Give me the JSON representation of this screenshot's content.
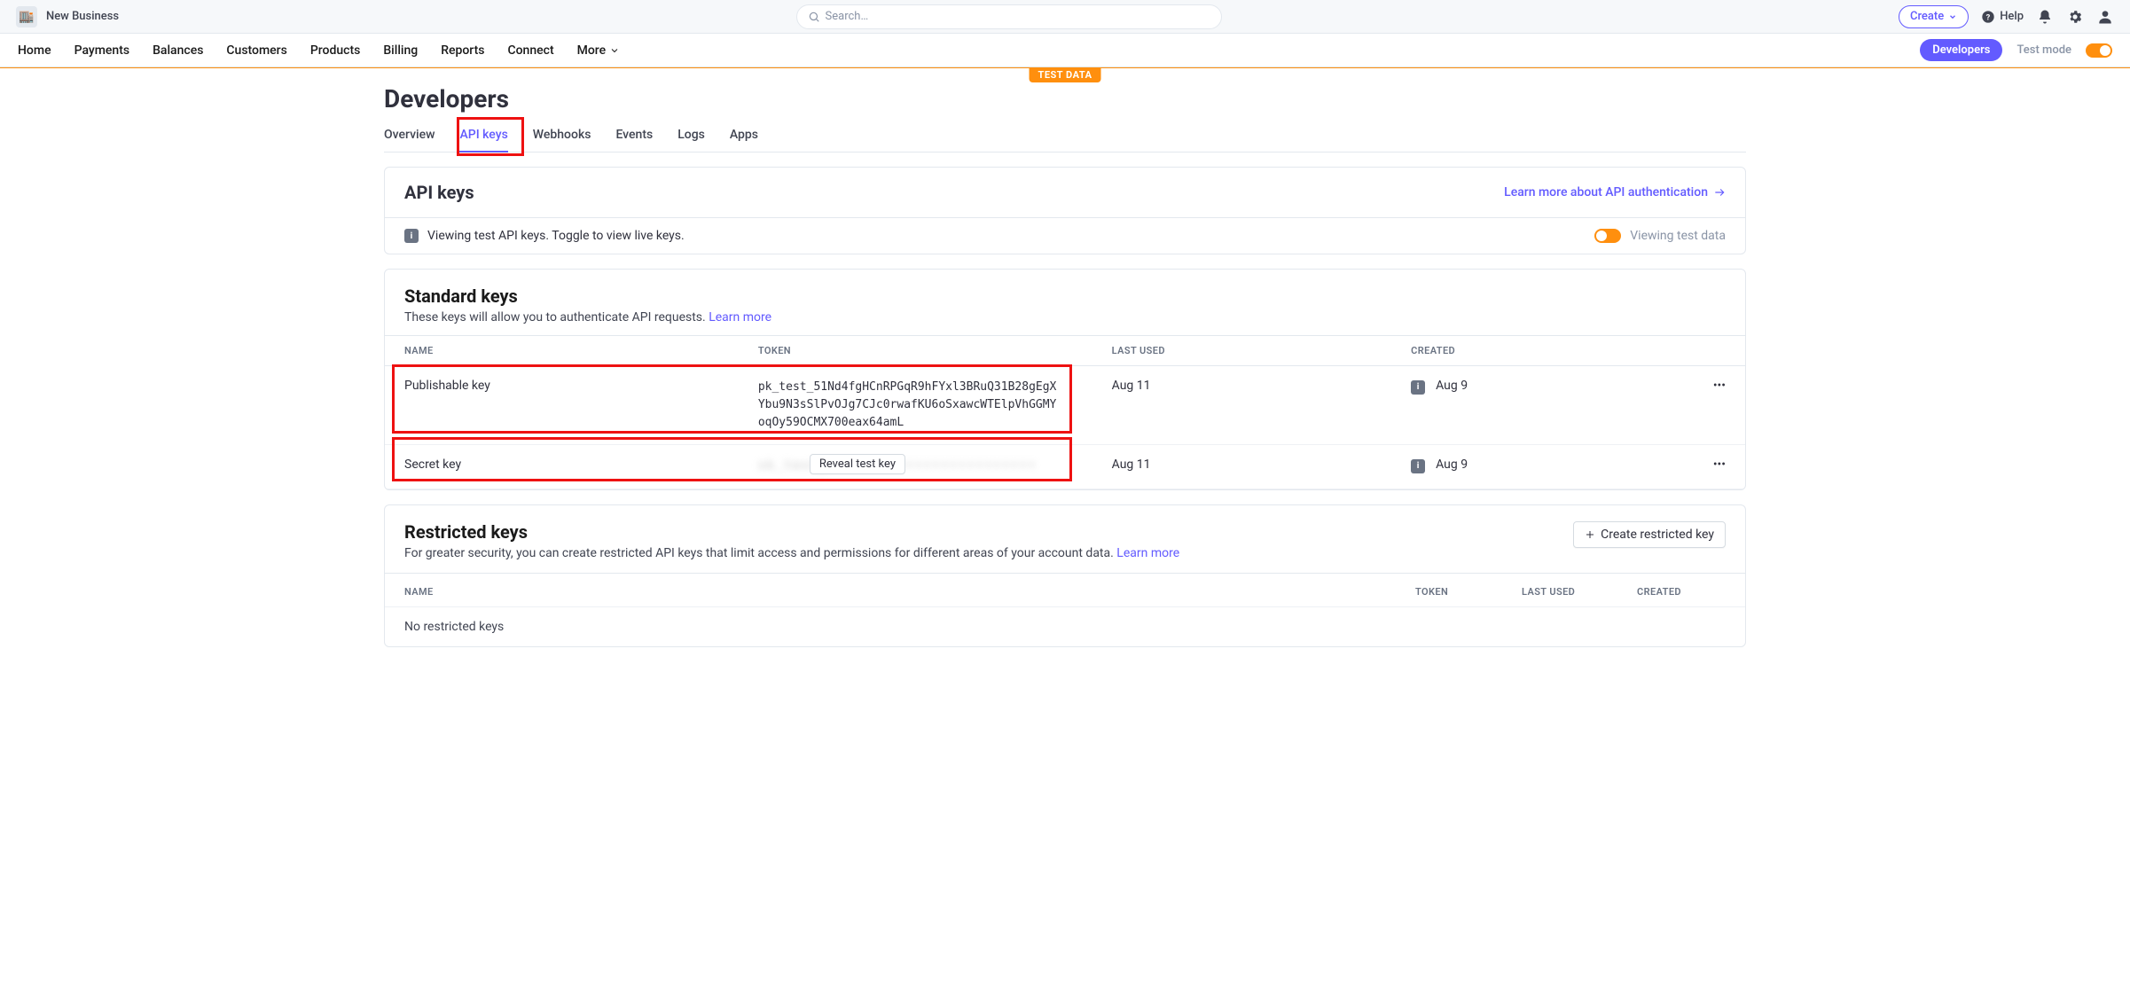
{
  "topbar": {
    "business": "New Business",
    "search_placeholder": "Search…",
    "create": "Create",
    "help": "Help"
  },
  "nav": {
    "items": [
      "Home",
      "Payments",
      "Balances",
      "Customers",
      "Products",
      "Billing",
      "Reports",
      "Connect",
      "More"
    ],
    "developers": "Developers",
    "test_mode": "Test mode"
  },
  "ribbon": "TEST DATA",
  "page_title": "Developers",
  "subtabs": [
    "Overview",
    "API keys",
    "Webhooks",
    "Events",
    "Logs",
    "Apps"
  ],
  "subtab_active": 1,
  "apikeys": {
    "heading": "API keys",
    "learn_more": "Learn more about API authentication",
    "note": "Viewing test API keys. Toggle to view live keys.",
    "viewing_test": "Viewing test data",
    "std_title": "Standard keys",
    "std_sub": "These keys will allow you to authenticate API requests. ",
    "learn": "Learn more",
    "columns": {
      "name": "NAME",
      "token": "TOKEN",
      "last": "LAST USED",
      "created": "CREATED"
    },
    "rows": [
      {
        "name": "Publishable key",
        "token": "pk_test_51Nd4fgHCnRPGqR9hFYxl3BRuQ31B28gEgXYbu9N3sSlPvOJg7CJc0rwafKU6oSxawcWTElpVhGGMYoqOy59OCMX700eax64amL",
        "last": "Aug 11",
        "created": "Aug 9"
      },
      {
        "name": "Secret key",
        "token_hidden": "sk_test_••••••••••••••••••••••••",
        "reveal": "Reveal test key",
        "last": "Aug 11",
        "created": "Aug 9"
      }
    ],
    "restricted_title": "Restricted keys",
    "restricted_sub": "For greater security, you can create restricted API keys that limit access and permissions for different areas of your account data. ",
    "create_restricted": "Create restricted key",
    "r_columns": {
      "name": "NAME",
      "token": "TOKEN",
      "last": "LAST USED",
      "created": "CREATED"
    },
    "empty": "No restricted keys"
  }
}
